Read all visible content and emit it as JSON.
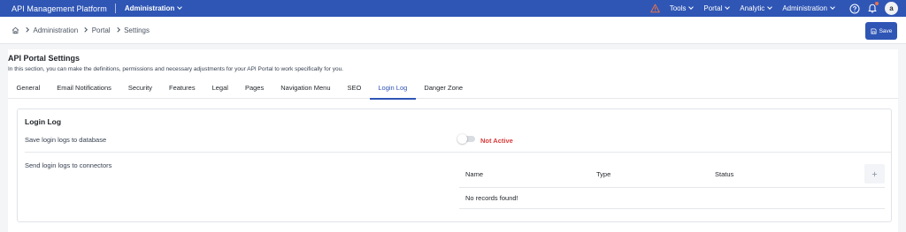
{
  "topbar": {
    "brand": "API Management Platform",
    "module": "Administration",
    "menus": [
      "Tools",
      "Portal",
      "Analytic",
      "Administration"
    ],
    "avatar_initial": "a",
    "accent": "#2f56b5",
    "warning_color": "#e8734a"
  },
  "breadcrumb": {
    "home_icon": "home-icon",
    "items": [
      "Administration",
      "Portal",
      "Settings"
    ]
  },
  "actions": {
    "save_label": "Save"
  },
  "page": {
    "title": "API Portal Settings",
    "description": "In this section, you can make the definitions, permissions and necessary adjustments for your API Portal to work specifically for you."
  },
  "tabs": [
    "General",
    "Email Notifications",
    "Security",
    "Features",
    "Legal",
    "Pages",
    "Navigation Menu",
    "SEO",
    "Login Log",
    "Danger Zone"
  ],
  "active_tab": "Login Log",
  "login_log": {
    "title": "Login Log",
    "save_logs_label": "Save login logs to database",
    "save_logs_status": "Not Active",
    "save_logs_enabled": false,
    "status_color": "#d93b3b",
    "connectors_label": "Send login logs to connectors",
    "table": {
      "columns": [
        "Name",
        "Type",
        "Status"
      ],
      "add_icon": "plus-icon",
      "empty_text": "No records found!"
    }
  }
}
